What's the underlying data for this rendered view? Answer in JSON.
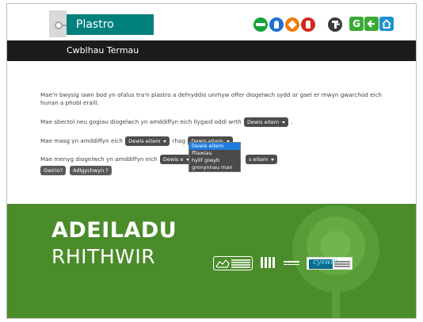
{
  "brand": {
    "name": "Plastro"
  },
  "header": {
    "signs": [
      "mandatory-green-icon",
      "mandatory-blue-icon",
      "warning-orange-icon",
      "prohibition-red-icon"
    ],
    "tools": {
      "glossary_icon": "t-icon",
      "glossary_label": "G",
      "back": "back-arrow-icon",
      "home": "home-icon"
    }
  },
  "titlebar": {
    "title": "Cwblhau Termau"
  },
  "intro": "Mae'n bwysig iawn bod yn ofalus tra'n plastro a defnyddio unrhyw offer diogelwch sydd ar gael er mwyn gwarchod eich hunan a phobl eraill.",
  "sentences": {
    "s1": {
      "before": "Mae sbectol neu gogiau diogelwch yn amddiffyn eich llygaid oddi wrth",
      "select": "Dewis eitem",
      "after": "."
    },
    "s2": {
      "before": "Mae masg yn amddiffyn eich",
      "select1": "Dewis eitem",
      "middle": "rhag",
      "select2": "Dewis eitem",
      "after": "."
    },
    "s3": {
      "before": "Mae menyg diogelwch yn amddiffyn eich",
      "select1": "Dewis e",
      "select2": "s eitem",
      "after": "."
    }
  },
  "dropdown": {
    "options": [
      "Dewis eitem",
      "ffiawiau",
      "hylif giwyb",
      "gronynnau man"
    ],
    "highlighted": 0
  },
  "buttons": {
    "check": "Gwirio?",
    "feedback": "Adlgychwyn ?"
  },
  "footer": {
    "line1": "ADEILADU",
    "line2": "RHITHWIR",
    "partner_logos": [
      "welsh-government-logo",
      "lottery-logo",
      "cadw-logo"
    ],
    "cadw_text": "cyswllt"
  },
  "colors": {
    "brand_teal": "#00807c",
    "footer_green": "#4b8c2a",
    "titlebar": "#1c1c1c",
    "highlight": "#1e7ce0"
  }
}
